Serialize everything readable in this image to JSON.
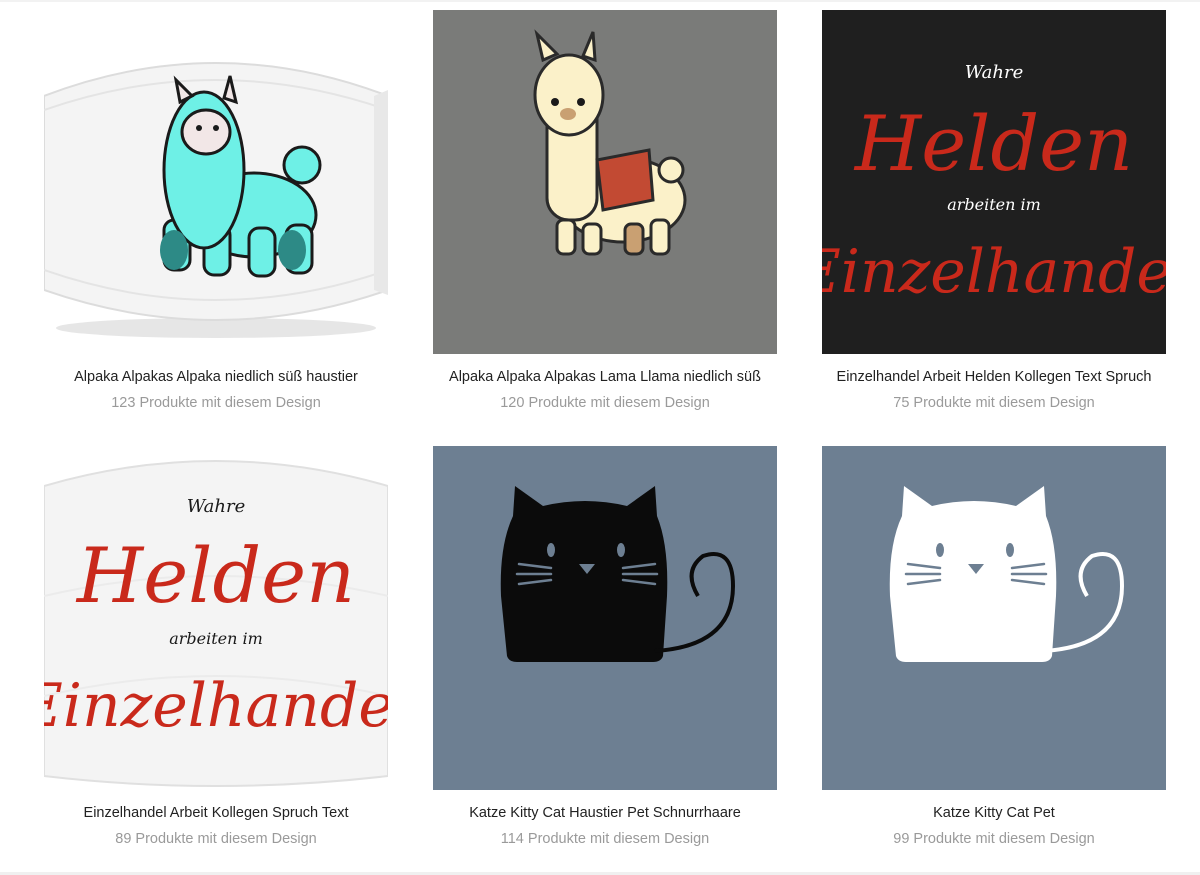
{
  "products": [
    {
      "title": "Alpaka Alpakas Alpaka niedlich süß haustier",
      "count": "123 Produkte mit diesem Design",
      "image": "turquoise-alpaca-on-face-mask"
    },
    {
      "title": "Alpaka Alpaka Alpakas Lama Llama niedlich süß",
      "count": "120 Produkte mit diesem Design",
      "image": "cream-llama-on-gray-shirt"
    },
    {
      "title": "Einzelhandel Arbeit Helden Kollegen Text Spruch",
      "count": "75 Produkte mit diesem Design",
      "image": "helden-text-on-black-shirt"
    },
    {
      "title": "Einzelhandel Arbeit Kollegen Spruch Text",
      "count": "89 Produkte mit diesem Design",
      "image": "helden-text-on-face-mask"
    },
    {
      "title": "Katze Kitty Cat Haustier Pet Schnurrhaare",
      "count": "114 Produkte mit diesem Design",
      "image": "black-cat-on-blue-shirt"
    },
    {
      "title": "Katze Kitty Cat Pet",
      "count": "99 Produkte mit diesem Design",
      "image": "white-cat-on-blue-shirt"
    }
  ],
  "design_text": {
    "small_top": "Wahre",
    "big_1": "Helden",
    "small_mid": "arbeiten im",
    "big_2": "Einzelhandel"
  },
  "colors": {
    "gray_shirt": "#7a7b79",
    "black_shirt": "#1f1f1f",
    "blue_shirt": "#6d7f92",
    "red_text": "#c9291b",
    "turquoise": "#6ef0e6"
  }
}
